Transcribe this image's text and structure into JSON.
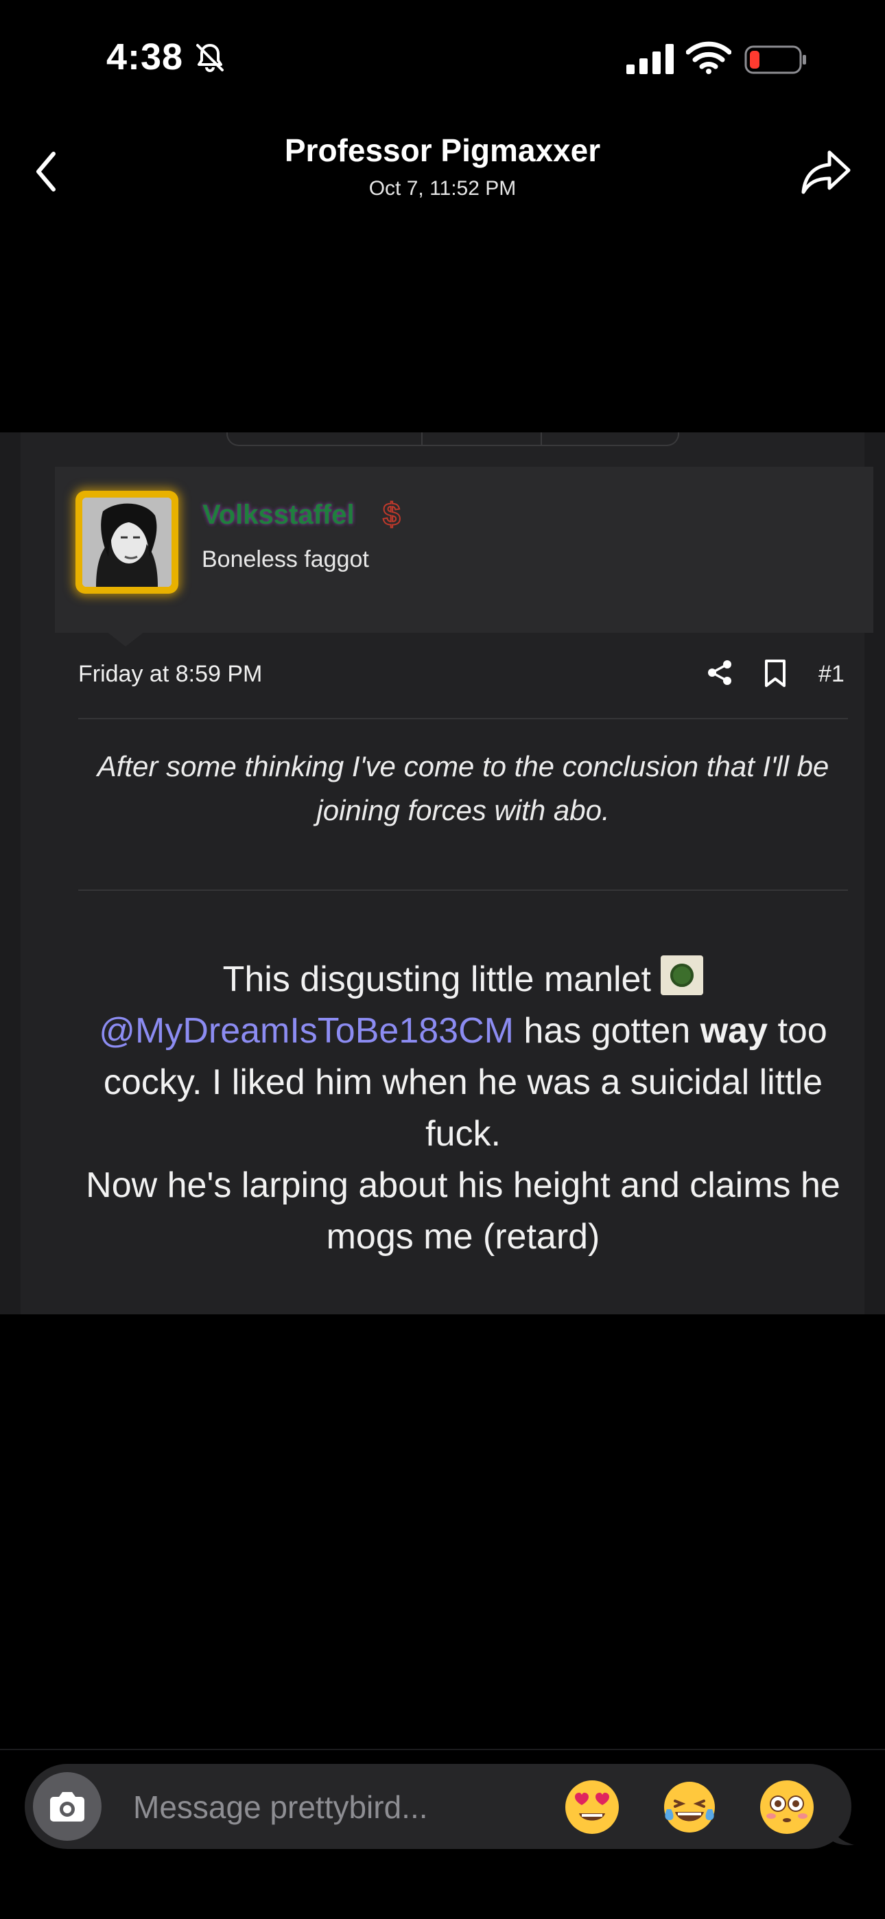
{
  "status_bar": {
    "time": "4:38",
    "icons": [
      "bell-slash-icon",
      "cellular-signal-icon",
      "wifi-icon",
      "battery-low-icon"
    ]
  },
  "header": {
    "title": "Professor Pigmaxxer",
    "subtitle": "Oct 7, 11:52 PM",
    "back_icon": "chevron-left-icon",
    "share_icon": "forward-arrow-icon"
  },
  "post": {
    "username": "Volksstaffel",
    "user_badge": "$",
    "user_title": "Boneless faggot",
    "timestamp": "Friday at 8:59 PM",
    "post_number": "#1",
    "quote": "After some thinking I've come to the conclusion that I'll be joining forces with abo.",
    "body": {
      "part1": "This disgusting little manlet",
      "mention": "@MyDreamIsToBe183CM",
      "part2": "has gotten",
      "bold": "way",
      "part3": "too cocky. I liked him when he was a suicidal little fuck.",
      "line2": "Now he's larping about his height and claims he mogs me (retard)"
    },
    "colors": {
      "username": "#1f7f3d",
      "mention": "#8c8cf2",
      "avatar_border": "#e8b100"
    }
  },
  "composer": {
    "placeholder": "Message prettybird...",
    "quick_reactions": [
      "😍",
      "😂",
      "😳"
    ]
  }
}
